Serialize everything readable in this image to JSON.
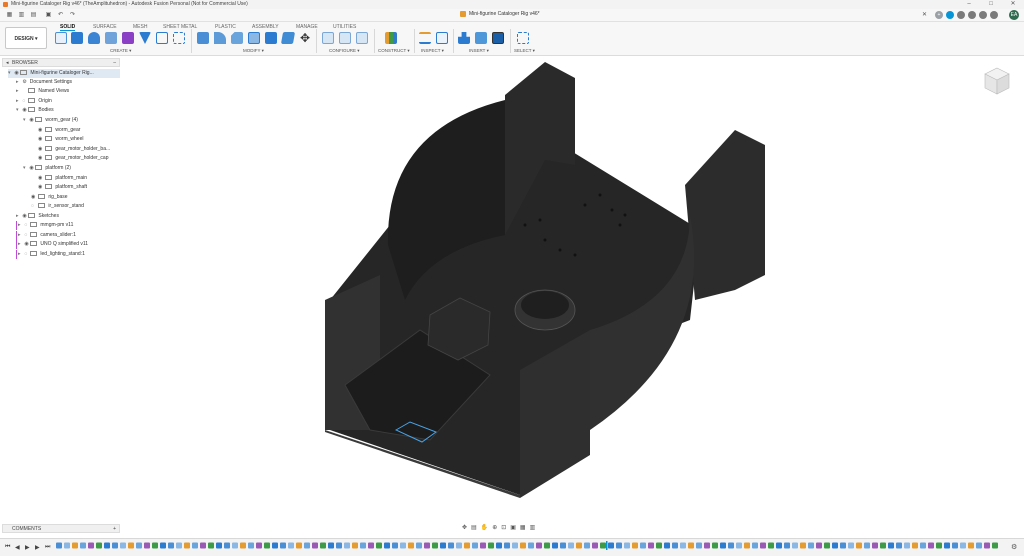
{
  "window": {
    "title": "Mini-figurine Cataloger Rig v46* (TheAmplituhedron) - Autodesk Fusion Personal (Not for Commercial Use)",
    "controls": [
      "–",
      "□",
      "✕"
    ]
  },
  "document_tab": {
    "label": "Mini-figurine Cataloger Rig v46*",
    "close": "✕"
  },
  "user_initials": "EA",
  "workspace_button": "DESIGN ▾",
  "ribbon_tabs": [
    "SOLID",
    "SURFACE",
    "MESH",
    "SHEET METAL",
    "PLASTIC",
    "ASSEMBLY",
    "MANAGE",
    "UTILITIES"
  ],
  "ribbon_groups": [
    "CREATE ▾",
    "MODIFY ▾",
    "CONFIGURE ▾",
    "CONSTRUCT ▾",
    "INSPECT ▾",
    "INSERT ▾",
    "SELECT ▾"
  ],
  "browser": {
    "title": "BROWSER",
    "items": [
      {
        "label": "Mini-figurine Cataloger Rig..."
      },
      {
        "label": "Document Settings"
      },
      {
        "label": "Named Views"
      },
      {
        "label": "Origin"
      },
      {
        "label": "Bodies"
      },
      {
        "label": "worm_gear (4)"
      },
      {
        "label": "worm_gear"
      },
      {
        "label": "worm_wheel"
      },
      {
        "label": "gear_motor_holder_ba..."
      },
      {
        "label": "gear_motor_holder_cap"
      },
      {
        "label": "platform (2)"
      },
      {
        "label": "platform_main"
      },
      {
        "label": "platform_shaft"
      },
      {
        "label": "rig_base"
      },
      {
        "label": "ir_sensor_stand"
      },
      {
        "label": "Sketches"
      },
      {
        "label": "mmgm-pm v11"
      },
      {
        "label": "camera_slider:1"
      },
      {
        "label": "UNO Q simplified v11"
      },
      {
        "label": "led_lighting_stand:1"
      }
    ]
  },
  "comments": {
    "title": "COMMENTS",
    "add": "+"
  },
  "timeline": {
    "controls": [
      "⏮",
      "◀",
      "▶",
      "▶",
      "⏭"
    ]
  },
  "colors": {
    "accent": "#0696d7",
    "model": "#2e2e2e",
    "brand": "#e8792b"
  }
}
